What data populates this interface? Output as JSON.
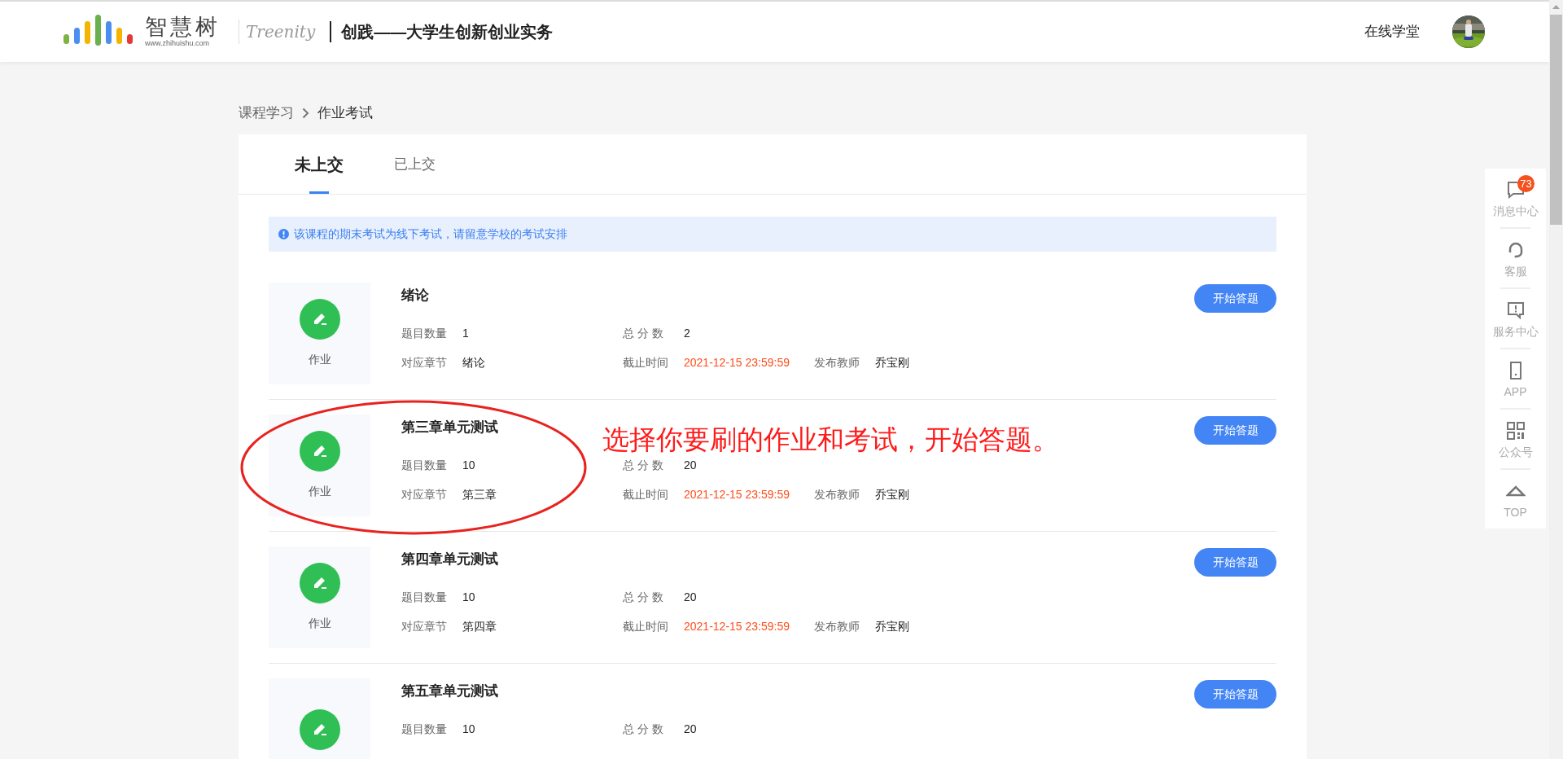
{
  "header": {
    "brand": "智慧树",
    "brand_url": "www.zhihuishu.com",
    "partner": "Treenity",
    "course_title": "创践——大学生创新创业实务",
    "nav_link": "在线学堂"
  },
  "breadcrumb": [
    "课程学习",
    "作业考试"
  ],
  "tabs": [
    {
      "label": "未上交",
      "selected": true
    },
    {
      "label": "已上交",
      "selected": false
    }
  ],
  "notice": "该课程的期末考试为线下考试，请留意学校的考试安排",
  "items": [
    {
      "title": "绪论",
      "label": "作业",
      "button": "开始答题",
      "rows": [
        [
          {
            "name": "题目数量",
            "value": "1"
          },
          {
            "name": "总 分 数",
            "value": "2"
          }
        ],
        [
          {
            "name": "对应章节",
            "value": "绪论"
          },
          {
            "name": "截止时间",
            "value": "2021-12-15 23:59:59",
            "kind": "deadline"
          },
          {
            "name": "发布教师",
            "value": "乔宝刚"
          }
        ]
      ]
    },
    {
      "title": "第三章单元测试",
      "label": "作业",
      "button": "开始答题",
      "rows": [
        [
          {
            "name": "题目数量",
            "value": "10"
          },
          {
            "name": "总 分 数",
            "value": "20"
          }
        ],
        [
          {
            "name": "对应章节",
            "value": "第三章"
          },
          {
            "name": "截止时间",
            "value": "2021-12-15 23:59:59",
            "kind": "deadline"
          },
          {
            "name": "发布教师",
            "value": "乔宝刚"
          }
        ]
      ]
    },
    {
      "title": "第四章单元测试",
      "label": "作业",
      "button": "开始答题",
      "rows": [
        [
          {
            "name": "题目数量",
            "value": "10"
          },
          {
            "name": "总 分 数",
            "value": "20"
          }
        ],
        [
          {
            "name": "对应章节",
            "value": "第四章"
          },
          {
            "name": "截止时间",
            "value": "2021-12-15 23:59:59",
            "kind": "deadline"
          },
          {
            "name": "发布教师",
            "value": "乔宝刚"
          }
        ]
      ]
    },
    {
      "title": "第五章单元测试",
      "button": "开始答题",
      "rows": [
        [
          {
            "name": "题目数量",
            "value": "10"
          },
          {
            "name": "总 分 数",
            "value": "20"
          }
        ]
      ]
    }
  ],
  "annotation": "选择你要刷的作业和考试，开始答题。",
  "side_toolbar": [
    {
      "kind": "message",
      "label": "消息中心",
      "badge": "73"
    },
    {
      "kind": "headset",
      "label": "客服"
    },
    {
      "kind": "service",
      "label": "服务中心"
    },
    {
      "kind": "phone",
      "label": "APP"
    },
    {
      "kind": "qr",
      "label": "公众号"
    },
    {
      "kind": "top",
      "label": "TOP"
    }
  ]
}
